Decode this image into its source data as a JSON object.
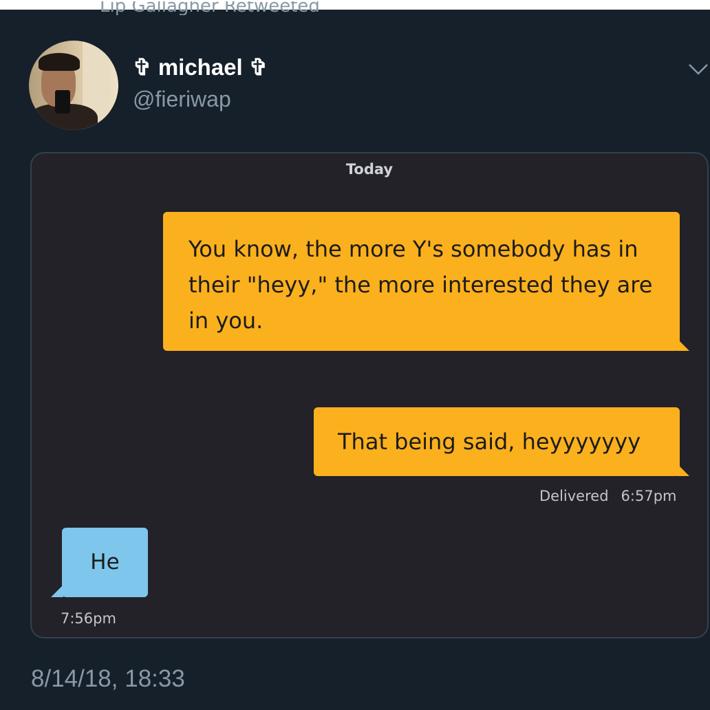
{
  "retweet": {
    "text": "Lip Gallagher Retweeted"
  },
  "author": {
    "name": "✞ michael ✞",
    "handle": "@fieriwap"
  },
  "menu": {
    "icon": "chevron-down-icon"
  },
  "colors": {
    "background": "#16202b",
    "outgoing_bubble": "#fbb01d",
    "incoming_bubble": "#7ec6ec",
    "card": "#222228"
  },
  "chat": {
    "date_header": "Today",
    "messages": [
      {
        "direction": "outgoing",
        "text": "You know, the more Y's somebody has in their \"heyy,\" the more interested they are in you."
      },
      {
        "direction": "outgoing",
        "text": "That being said, heyyyyyyy"
      },
      {
        "direction": "incoming",
        "text": "He"
      }
    ],
    "delivered_label": "Delivered",
    "delivered_time": "6:57pm",
    "received_time": "7:56pm"
  },
  "tweet": {
    "timestamp": "8/14/18, 18:33"
  }
}
